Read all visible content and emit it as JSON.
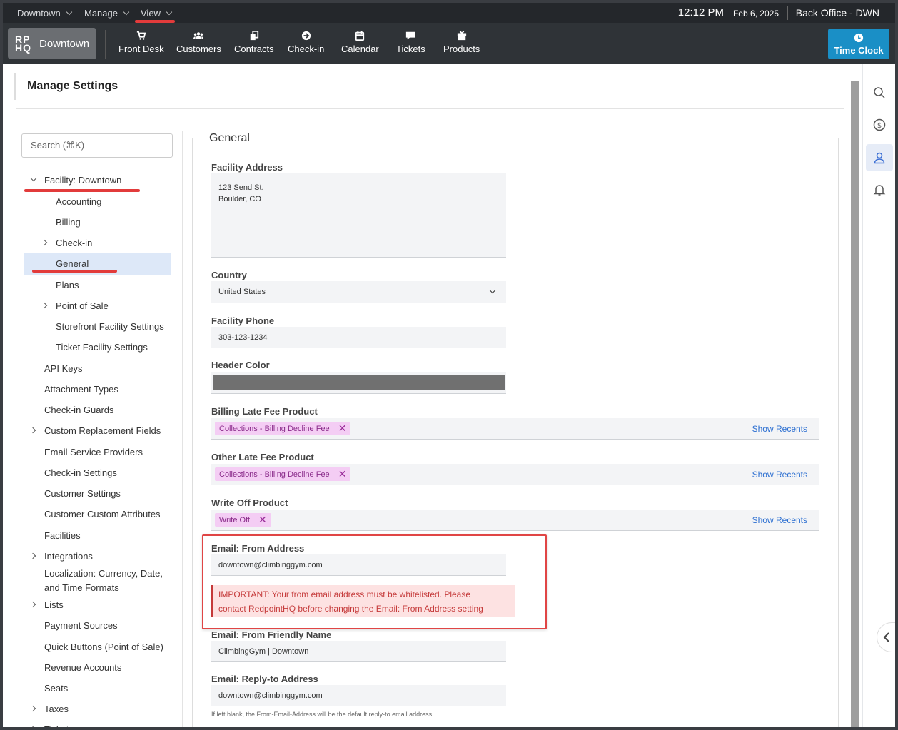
{
  "topbar": {
    "menus": [
      "Downtown",
      "Manage",
      "View"
    ],
    "time": "12:12 PM",
    "date": "Feb 6, 2025",
    "context": "Back Office - DWN"
  },
  "nav": {
    "brand_logo_line1": "RP",
    "brand_logo_line2": "HQ",
    "brand_name": "Downtown",
    "items": [
      {
        "label": "Front Desk",
        "icon": "cart-icon"
      },
      {
        "label": "Customers",
        "icon": "users-icon"
      },
      {
        "label": "Contracts",
        "icon": "contracts-icon"
      },
      {
        "label": "Check-in",
        "icon": "arrow-circle-icon"
      },
      {
        "label": "Calendar",
        "icon": "calendar-icon"
      },
      {
        "label": "Tickets",
        "icon": "chat-icon"
      },
      {
        "label": "Products",
        "icon": "box-icon"
      }
    ],
    "time_clock": "Time Clock"
  },
  "page": {
    "title": "Manage Settings",
    "search_placeholder": "Search (⌘K)"
  },
  "sidebar": {
    "facility": "Facility: Downtown",
    "items": [
      "Accounting",
      "Billing",
      "Check-in",
      "General",
      "Plans",
      "Point of Sale",
      "Storefront Facility Settings",
      "Ticket Facility Settings",
      "API Keys",
      "Attachment Types",
      "Check-in Guards",
      "Custom Replacement Fields",
      "Email Service Providers",
      "Check-in Settings",
      "Customer Settings",
      "Customer Custom Attributes",
      "Facilities",
      "Integrations",
      "Localization: Currency, Date,",
      "and Time Formats",
      "Lists",
      "Payment Sources",
      "Quick Buttons (Point of Sale)",
      "Revenue Accounts",
      "Seats",
      "Taxes",
      "Tickets"
    ]
  },
  "form": {
    "legend": "General",
    "facility_address_label": "Facility Address",
    "facility_address_line1": "123 Send St.",
    "facility_address_line2": "Boulder, CO",
    "country_label": "Country",
    "country_value": "United States",
    "phone_label": "Facility Phone",
    "phone_value": "303-123-1234",
    "header_color_label": "Header Color",
    "header_color_value": "#707070",
    "billing_late_label": "Billing Late Fee Product",
    "billing_late_chip": "Collections - Billing Decline Fee",
    "other_late_label": "Other Late Fee Product",
    "other_late_chip": "Collections - Billing Decline Fee",
    "write_off_label": "Write Off Product",
    "write_off_chip": "Write Off",
    "show_recents": "Show Recents",
    "from_address_label": "Email: From Address",
    "from_address_value": "downtown@climbinggym.com",
    "warning_line1": "IMPORTANT: Your from email address must be whitelisted. Please",
    "warning_line2": "contact RedpointHQ before changing the Email: From Address setting",
    "friendly_name_label": "Email: From Friendly Name",
    "friendly_name_value": "ClimbingGym | Downtown",
    "reply_to_label": "Email: Reply-to Address",
    "reply_to_value": "downtown@climbinggym.com",
    "reply_to_hint": "If left blank, the From-Email-Address will be the default reply-to email address."
  },
  "colors": {
    "accent": "#1a8fc6",
    "chip_bg": "#f4cdf4",
    "warning": "#c53a3a",
    "annotation": "#e23b3b"
  }
}
